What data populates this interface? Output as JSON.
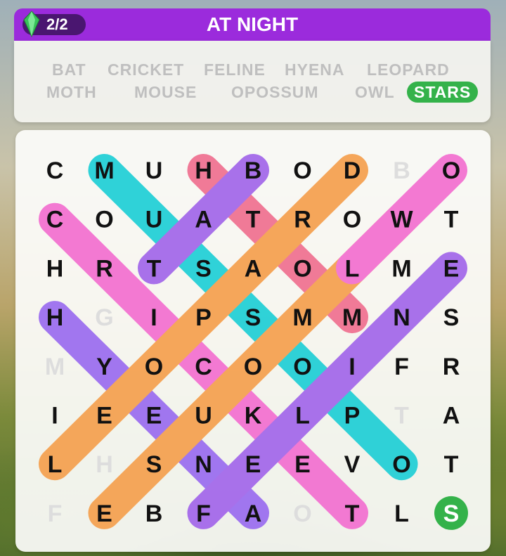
{
  "header": {
    "level": "2/2",
    "title": "AT NIGHT",
    "color": "#9b2bdc"
  },
  "words": [
    {
      "text": "BAT",
      "found": false
    },
    {
      "text": "CRICKET",
      "found": false
    },
    {
      "text": "FELINE",
      "found": false
    },
    {
      "text": "HYENA",
      "found": false
    },
    {
      "text": "LEOPARD",
      "found": false
    },
    {
      "text": "MOTH",
      "found": false
    },
    {
      "text": "MOUSE",
      "found": false
    },
    {
      "text": "OPOSSUM",
      "found": false
    },
    {
      "text": "OWL",
      "found": false
    },
    {
      "text": "STARS",
      "found": true
    }
  ],
  "grid": [
    [
      "C",
      "M",
      "U",
      "H",
      "B",
      "O",
      "D",
      "B",
      "O"
    ],
    [
      "C",
      "O",
      "U",
      "A",
      "T",
      "R",
      "O",
      "W",
      "T"
    ],
    [
      "H",
      "R",
      "T",
      "S",
      "A",
      "O",
      "L",
      "M",
      "E"
    ],
    [
      "H",
      "G",
      "I",
      "P",
      "S",
      "M",
      "M",
      "N",
      "S"
    ],
    [
      "M",
      "Y",
      "O",
      "C",
      "O",
      "O",
      "I",
      "F",
      "R"
    ],
    [
      "I",
      "E",
      "E",
      "U",
      "K",
      "L",
      "P",
      "T",
      "A"
    ],
    [
      "L",
      "H",
      "S",
      "N",
      "E",
      "E",
      "V",
      "O",
      "T"
    ],
    [
      "F",
      "E",
      "B",
      "F",
      "A",
      "O",
      "T",
      "L",
      "S"
    ]
  ],
  "faded_cells": [
    [
      0,
      7
    ],
    [
      3,
      1
    ],
    [
      4,
      0
    ],
    [
      5,
      7
    ],
    [
      6,
      1
    ],
    [
      7,
      0
    ],
    [
      7,
      5
    ]
  ],
  "found_letter_cells": [
    [
      7,
      8
    ]
  ],
  "highlights": [
    {
      "word": "MOUSE",
      "from": [
        0,
        1
      ],
      "to": [
        6,
        7
      ],
      "color": "#1fcfd6"
    },
    {
      "word": "HYENA",
      "from": [
        3,
        0
      ],
      "to": [
        7,
        4
      ],
      "color": "#9a6cf0"
    },
    {
      "word": "CRICKET",
      "from": [
        1,
        0
      ],
      "to": [
        7,
        6
      ],
      "color": "#f36fd0"
    },
    {
      "word": "MOTH",
      "from": [
        0,
        3
      ],
      "to": [
        3,
        6
      ],
      "color": "#f07090"
    },
    {
      "word": "BAT",
      "from": [
        0,
        4
      ],
      "to": [
        2,
        2
      ],
      "color": "#a266ea"
    },
    {
      "word": "LEOPARD",
      "from": [
        6,
        0
      ],
      "to": [
        0,
        6
      ],
      "color": "#f5a04e"
    },
    {
      "word": "OPOSSUM",
      "from": [
        7,
        1
      ],
      "to": [
        1,
        7
      ],
      "color": "#f5a04e"
    },
    {
      "word": "FELINE",
      "from": [
        7,
        3
      ],
      "to": [
        2,
        8
      ],
      "color": "#a266ea"
    },
    {
      "word": "OWL",
      "from": [
        0,
        8
      ],
      "to": [
        2,
        6
      ],
      "color": "#f36fd0"
    }
  ],
  "colors": {
    "letter": "#111111",
    "faded_letter": "#dddddd",
    "found_word": "#34b24a"
  }
}
